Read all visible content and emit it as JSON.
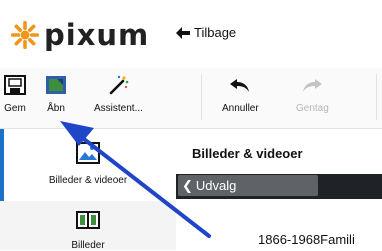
{
  "header": {
    "logo_text": "pixum",
    "back_label": "Tilbage"
  },
  "toolbar": {
    "items": [
      {
        "label": "Gem",
        "icon": "save-icon",
        "enabled": true
      },
      {
        "label": "Åbn",
        "icon": "open-icon",
        "enabled": true
      },
      {
        "label": "Assistent...",
        "icon": "assistant-icon",
        "enabled": true
      },
      {
        "label": "Annuller",
        "icon": "undo-icon",
        "enabled": true
      },
      {
        "label": "Gentag",
        "icon": "redo-icon",
        "enabled": false
      }
    ]
  },
  "sidebar": {
    "items": [
      {
        "label": "Billeder & videoer",
        "icon": "photos-videos-icon",
        "active": true
      },
      {
        "label": "Billeder",
        "icon": "album-icon",
        "active": false
      }
    ]
  },
  "main": {
    "title": "Billeder & videoer",
    "udvalg_label": "Udvalg",
    "album_label": "1866-1968Famili"
  },
  "colors": {
    "accent": "#1a73c8",
    "logo_orange": "#f0961b",
    "arrow": "#1f45c9",
    "dark_bar": "#1f2328"
  }
}
